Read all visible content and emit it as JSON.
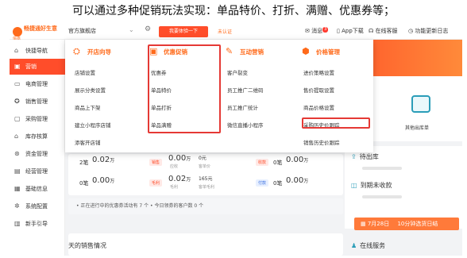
{
  "caption": "可以通过多种促销玩法实现：单品特价、打折、满赠、优惠券等；",
  "topbar": {
    "logo_text": "畅捷通好生意",
    "logo_sub": "佰嘉",
    "store_name": "官方旗舰店",
    "upgrade_label": "我要体验一下",
    "unverified_label": "未认证",
    "messages_label": "消息",
    "messages_badge": "3",
    "app_download_label": "App下载",
    "online_cs_label": "在线客服",
    "update_label": "功能更新日志"
  },
  "sidebar": {
    "items": [
      {
        "label": "快捷导航",
        "icon": "home-icon",
        "glyph": "⌂"
      },
      {
        "label": "营销",
        "icon": "marketing-icon",
        "glyph": "▣"
      },
      {
        "label": "电商管理",
        "icon": "ecommerce-icon",
        "glyph": "▭"
      },
      {
        "label": "销售管理",
        "icon": "sales-icon",
        "glyph": "✪"
      },
      {
        "label": "采购管理",
        "icon": "purchase-icon",
        "glyph": "▢"
      },
      {
        "label": "库存核算",
        "icon": "inventory-icon",
        "glyph": "⌂"
      },
      {
        "label": "资金管理",
        "icon": "funds-icon",
        "glyph": "⊛"
      },
      {
        "label": "经营管理",
        "icon": "operation-icon",
        "glyph": "▤"
      },
      {
        "label": "基础信息",
        "icon": "basic-info-icon",
        "glyph": "▦"
      },
      {
        "label": "系统配置",
        "icon": "settings-icon",
        "glyph": "✲"
      },
      {
        "label": "新手引导",
        "icon": "guide-icon",
        "glyph": "▥"
      }
    ],
    "active_index": 1
  },
  "mega_menu": {
    "columns": [
      {
        "title": "开店向导",
        "icon": "store-guide-icon",
        "items": [
          "店铺设置",
          "展示分类设置",
          "商品上下架",
          "建立小程序店铺",
          "添客开店铺"
        ]
      },
      {
        "title": "优惠促销",
        "icon": "promotion-icon",
        "items": [
          "优惠券",
          "单品特价",
          "单品打折",
          "单品满赠"
        ]
      },
      {
        "title": "互动营销",
        "icon": "interactive-marketing-icon",
        "items": [
          "客户裂变",
          "员工推广二维码",
          "员工推广统计",
          "微信直播小程序"
        ]
      },
      {
        "title": "价格管理",
        "icon": "price-management-icon",
        "items": [
          "进价策略设置",
          "售价提取设置",
          "商品价格设置",
          "采购历史价跟踪",
          "销售历史价跟踪"
        ]
      }
    ]
  },
  "dashboard": {
    "row1": [
      {
        "count_label": "2笔",
        "amount": "0.02",
        "unit": "万"
      },
      {
        "tag": "销售",
        "amount": "0.00",
        "unit": "万",
        "sub": "0元",
        "sub_caption": "应收",
        "sub_caption2": "客单价"
      },
      {
        "tag": "收款",
        "count_label": "0笔",
        "amount": "0.00",
        "unit": "万"
      }
    ],
    "row2": [
      {
        "count_label": "0笔",
        "amount": "0.00",
        "unit": "万"
      },
      {
        "tag": "毛利",
        "amount": "0.02",
        "unit": "万",
        "sub": "165元",
        "sub_caption": "毛利",
        "sub_caption2": "客单毛利"
      },
      {
        "tag": "付款",
        "count_label": "0笔",
        "amount": "0.00",
        "unit": "万"
      }
    ],
    "notice_1": "正在进行中的优惠券活动有 7 个",
    "notice_2": "今日领券的客户数 0 个",
    "sales_title": "天的销售情况"
  },
  "right_panel": {
    "shortcut_label": "其他出库单",
    "pending_out": "待出库",
    "pending_collect": "到期未收款",
    "banner_date": "7月28日",
    "banner_text": "10分钟选货日结",
    "online_service": "在线服务"
  }
}
